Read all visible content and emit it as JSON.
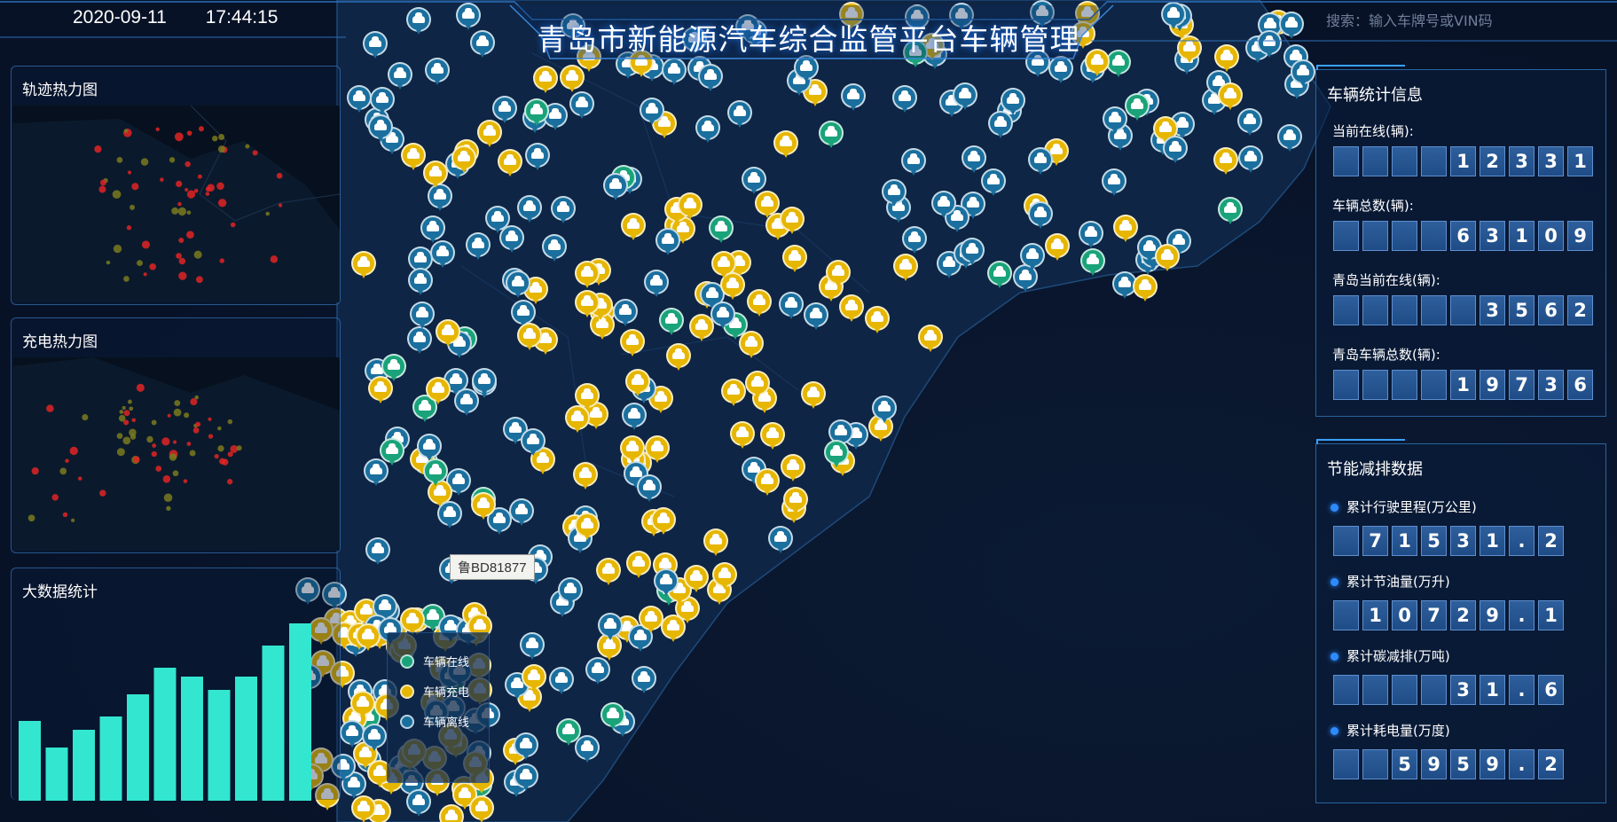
{
  "header": {
    "date": "2020-09-11",
    "time": "17:44:15",
    "title": "青岛市新能源汽车综合监管平台车辆管理",
    "search_placeholder": "搜索：输入车牌号或VIN码"
  },
  "left_panels": {
    "trajectory_heatmap_title": "轨迹热力图",
    "charging_heatmap_title": "充电热力图",
    "big_data_title": "大数据统计"
  },
  "chart_data": {
    "type": "bar",
    "title": "大数据统计",
    "values": [
      90,
      60,
      80,
      95,
      120,
      150,
      140,
      125,
      140,
      175,
      200
    ],
    "ylim": [
      0,
      200
    ],
    "color": "#33e6d0"
  },
  "legend": {
    "items": [
      {
        "label": "车辆在线",
        "color": "#1aa37a"
      },
      {
        "label": "车辆充电",
        "color": "#e6b600"
      },
      {
        "label": "车辆离线",
        "color": "#1a6f9e"
      }
    ]
  },
  "map": {
    "tooltip": "鲁BD81877",
    "pin_colors": {
      "online": "#1aa37a",
      "charging": "#e6b600",
      "offline": "#1a6f9e"
    }
  },
  "vehicle_stats": {
    "title": "车辆统计信息",
    "items": [
      {
        "label": "当前在线(辆):",
        "digits": [
          "",
          "",
          "",
          "",
          "1",
          "2",
          "3",
          "3",
          "1"
        ]
      },
      {
        "label": "车辆总数(辆):",
        "digits": [
          "",
          "",
          "",
          "",
          "6",
          "3",
          "1",
          "0",
          "9"
        ]
      },
      {
        "label": "青岛当前在线(辆):",
        "digits": [
          "",
          "",
          "",
          "",
          "",
          "3",
          "5",
          "6",
          "2"
        ]
      },
      {
        "label": "青岛车辆总数(辆):",
        "digits": [
          "",
          "",
          "",
          "",
          "1",
          "9",
          "7",
          "3",
          "6"
        ]
      }
    ]
  },
  "energy_stats": {
    "title": "节能减排数据",
    "items": [
      {
        "label": "累计行驶里程(万公里)",
        "digits": [
          "",
          "7",
          "1",
          "5",
          "3",
          "1",
          ".",
          "2"
        ]
      },
      {
        "label": "累计节油量(万升)",
        "digits": [
          "",
          "1",
          "0",
          "7",
          "2",
          "9",
          ".",
          "1"
        ]
      },
      {
        "label": "累计碳减排(万吨)",
        "digits": [
          "",
          "",
          "",
          "",
          "3",
          "1",
          ".",
          "6"
        ]
      },
      {
        "label": "累计耗电量(万度)",
        "digits": [
          "",
          "",
          "5",
          "9",
          "5",
          "9",
          ".",
          "2"
        ]
      }
    ]
  }
}
